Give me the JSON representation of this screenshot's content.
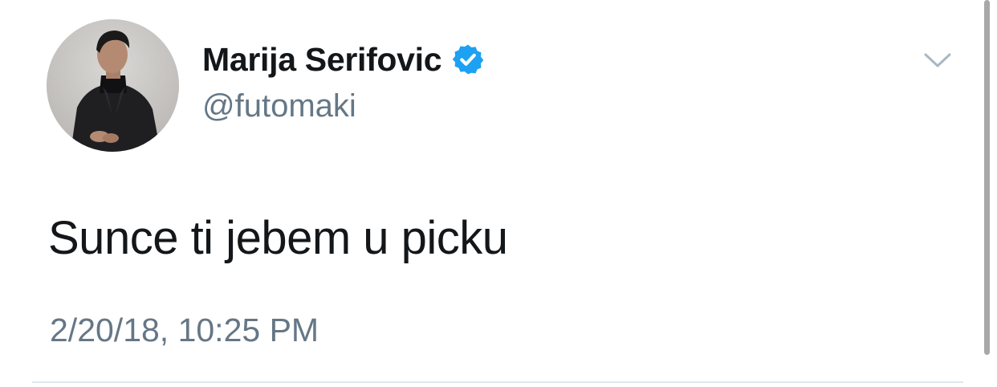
{
  "tweet": {
    "author": {
      "display_name": "Marija Serifovic",
      "handle": "@futomaki",
      "verified": true,
      "avatar_icon": "profile-photo"
    },
    "text": "Sunce ti jebem u picku",
    "timestamp": "2/20/18, 10:25 PM",
    "menu_icon": "chevron-down-icon"
  },
  "colors": {
    "name": "#14171a",
    "secondary": "#657786",
    "verified_badge": "#1da1f2",
    "divider": "#e1e8ed",
    "background": "#ffffff"
  }
}
